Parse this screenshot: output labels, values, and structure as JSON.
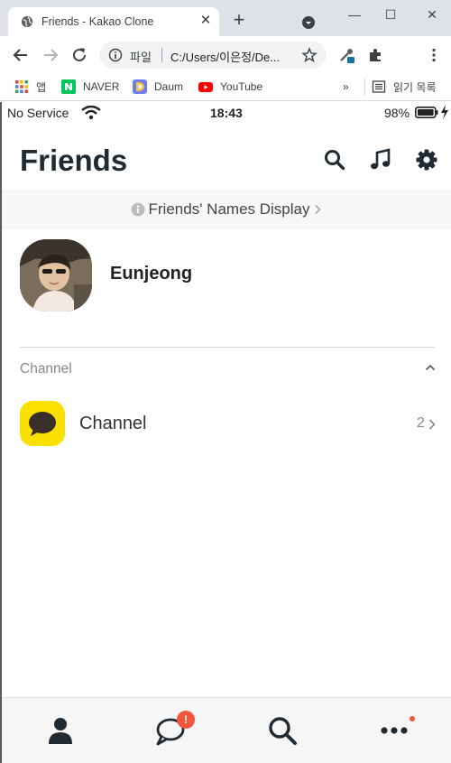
{
  "browser": {
    "tab_title": "Friends - Kakao Clone",
    "close_glyph": "✕",
    "newtab_glyph": "+",
    "window_controls": {
      "minimize": "—",
      "maximize": "☐",
      "close": "✕"
    },
    "omnibox": {
      "scheme_label": "파일",
      "url": "C:/Users/이은정/De..."
    },
    "bookmarks": [
      {
        "label": "앱",
        "icon": "apps-grid-icon"
      },
      {
        "label": "NAVER",
        "icon": "naver-icon"
      },
      {
        "label": "Daum",
        "icon": "daum-icon"
      },
      {
        "label": "YouTube",
        "icon": "youtube-icon"
      }
    ],
    "bookmarks_overflow": "»",
    "reading_list_label": "읽기 목록",
    "colors": {
      "tabstrip": "#dee1e6",
      "omnibox": "#f1f3f4"
    }
  },
  "status_bar": {
    "carrier": "No Service",
    "time": "18:43",
    "battery": "98%"
  },
  "header": {
    "title": "Friends",
    "icons": [
      "search-icon",
      "music-icon",
      "settings-icon"
    ]
  },
  "names_display": {
    "label": "Friends' Names Display"
  },
  "profile": {
    "name": "Eunjeong"
  },
  "channel_section": {
    "label": "Channel",
    "items": [
      {
        "name": "Channel",
        "count": "2"
      }
    ]
  },
  "tab_bar": {
    "items": [
      "friends-tab",
      "chats-tab",
      "search-tab",
      "more-tab"
    ],
    "chats_badge": "!"
  },
  "colors": {
    "kakao_yellow": "#fae100",
    "badge_red": "#f2563c",
    "title_text": "#1f2a33"
  }
}
